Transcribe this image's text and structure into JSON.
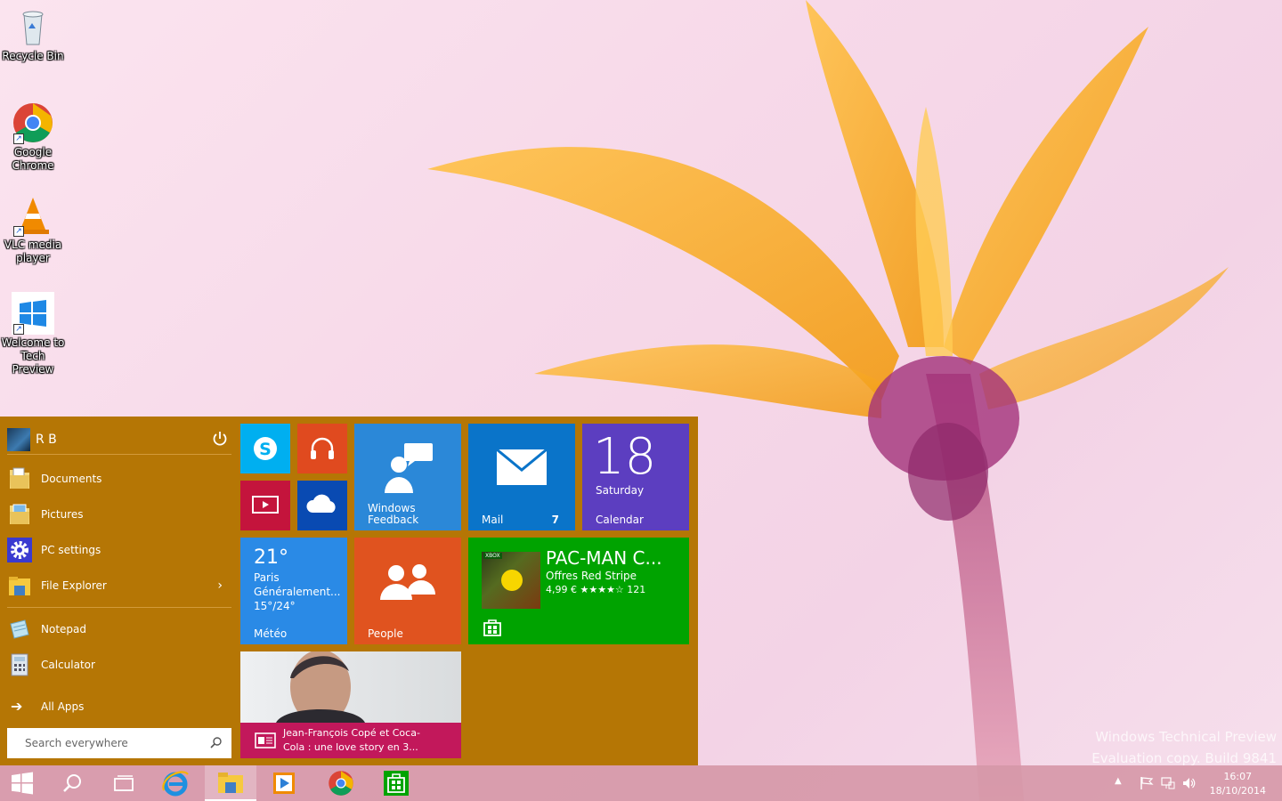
{
  "desktop": {
    "icons": [
      {
        "label": "Recycle Bin",
        "icon": "recycle-bin-icon"
      },
      {
        "label": "Google Chrome",
        "icon": "chrome-icon"
      },
      {
        "label": "VLC media player",
        "icon": "vlc-icon"
      },
      {
        "label": "Welcome to Tech Preview",
        "icon": "windows-logo-icon"
      }
    ],
    "watermark_line1": "Windows Technical Preview",
    "watermark_line2": "Evaluation copy. Build 9841"
  },
  "start_menu": {
    "background": "#b57605",
    "user_name": "R B",
    "items": [
      {
        "label": "Documents",
        "icon": "documents-folder-icon"
      },
      {
        "label": "Pictures",
        "icon": "pictures-folder-icon"
      },
      {
        "label": "PC settings",
        "icon": "gear-icon"
      },
      {
        "label": "File Explorer",
        "icon": "file-explorer-icon",
        "submenu_arrow": "›"
      },
      {
        "label": "Notepad",
        "icon": "notepad-icon"
      },
      {
        "label": "Calculator",
        "icon": "calculator-icon"
      }
    ],
    "all_apps": "All Apps",
    "search_placeholder": "Search everywhere",
    "tiles": {
      "skype": {
        "icon": "skype-icon",
        "color": "#00aff0"
      },
      "music": {
        "icon": "headphones-icon",
        "color": "#e04a1f"
      },
      "video": {
        "icon": "video-icon",
        "color": "#c4143c"
      },
      "onedrive": {
        "icon": "cloud-icon",
        "color": "#094ab2"
      },
      "feedback": {
        "label_line1": "Windows",
        "label_line2": "Feedback",
        "color": "#2b88d8"
      },
      "mail": {
        "label": "Mail",
        "badge": "7",
        "color": "#0a74c9"
      },
      "calendar": {
        "day": "18",
        "weekday": "Saturday",
        "label": "Calendar",
        "color": "#5c3ec0"
      },
      "weather": {
        "temp": "21°",
        "city": "Paris",
        "desc": "Généralement...",
        "range": "15°/24°",
        "label": "Météo",
        "color": "#2a8ae6"
      },
      "people": {
        "label": "People",
        "color": "#e0531f"
      },
      "store_app": {
        "title": "PAC-MAN C...",
        "subtitle": "Offres Red Stripe",
        "price_rating": "4,99 € ★★★★☆ 121",
        "badge": "XBOX",
        "color": "#00a300"
      },
      "news": {
        "headline_line1": "Jean-François Copé et Coca-",
        "headline_line2": "Cola : une love story en 3...",
        "color": "#c2185b"
      }
    }
  },
  "taskbar": {
    "buttons": [
      {
        "name": "start-button",
        "icon": "windows-logo-icon"
      },
      {
        "name": "search-button",
        "icon": "search-icon"
      },
      {
        "name": "task-view-button",
        "icon": "task-view-icon"
      },
      {
        "name": "internet-explorer-button",
        "icon": "ie-icon"
      },
      {
        "name": "file-explorer-button",
        "icon": "folder-icon"
      },
      {
        "name": "media-player-button",
        "icon": "media-player-icon"
      },
      {
        "name": "chrome-button",
        "icon": "chrome-icon"
      },
      {
        "name": "store-button",
        "icon": "store-icon"
      }
    ],
    "clock_time": "16:07",
    "clock_date": "18/10/2014"
  }
}
